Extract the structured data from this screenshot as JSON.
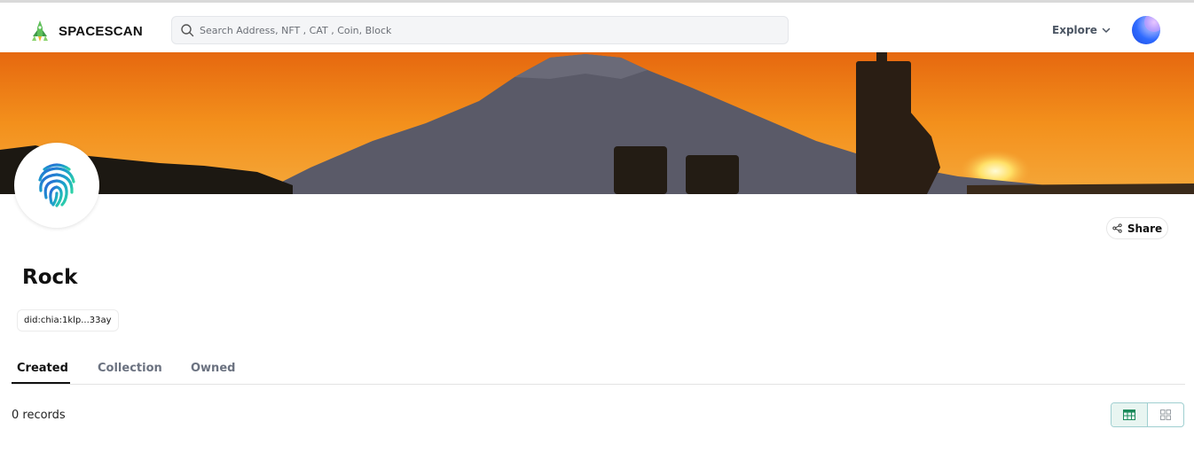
{
  "header": {
    "brand": "SPACESCAN",
    "search_placeholder": "Search Address, NFT , CAT , Coin, Block",
    "explore_label": "Explore"
  },
  "profile": {
    "name": "Rock",
    "did": "did:chia:1klp...33ay",
    "share_label": "Share"
  },
  "tabs": [
    {
      "label": "Created",
      "active": true
    },
    {
      "label": "Collection",
      "active": false
    },
    {
      "label": "Owned",
      "active": false
    }
  ],
  "content": {
    "records_text": "0 records",
    "view_mode": "table"
  },
  "colors": {
    "accent": "#1a8a5a",
    "toggle_border": "#9fcfd0",
    "banner_sky": "#f08a1a"
  }
}
